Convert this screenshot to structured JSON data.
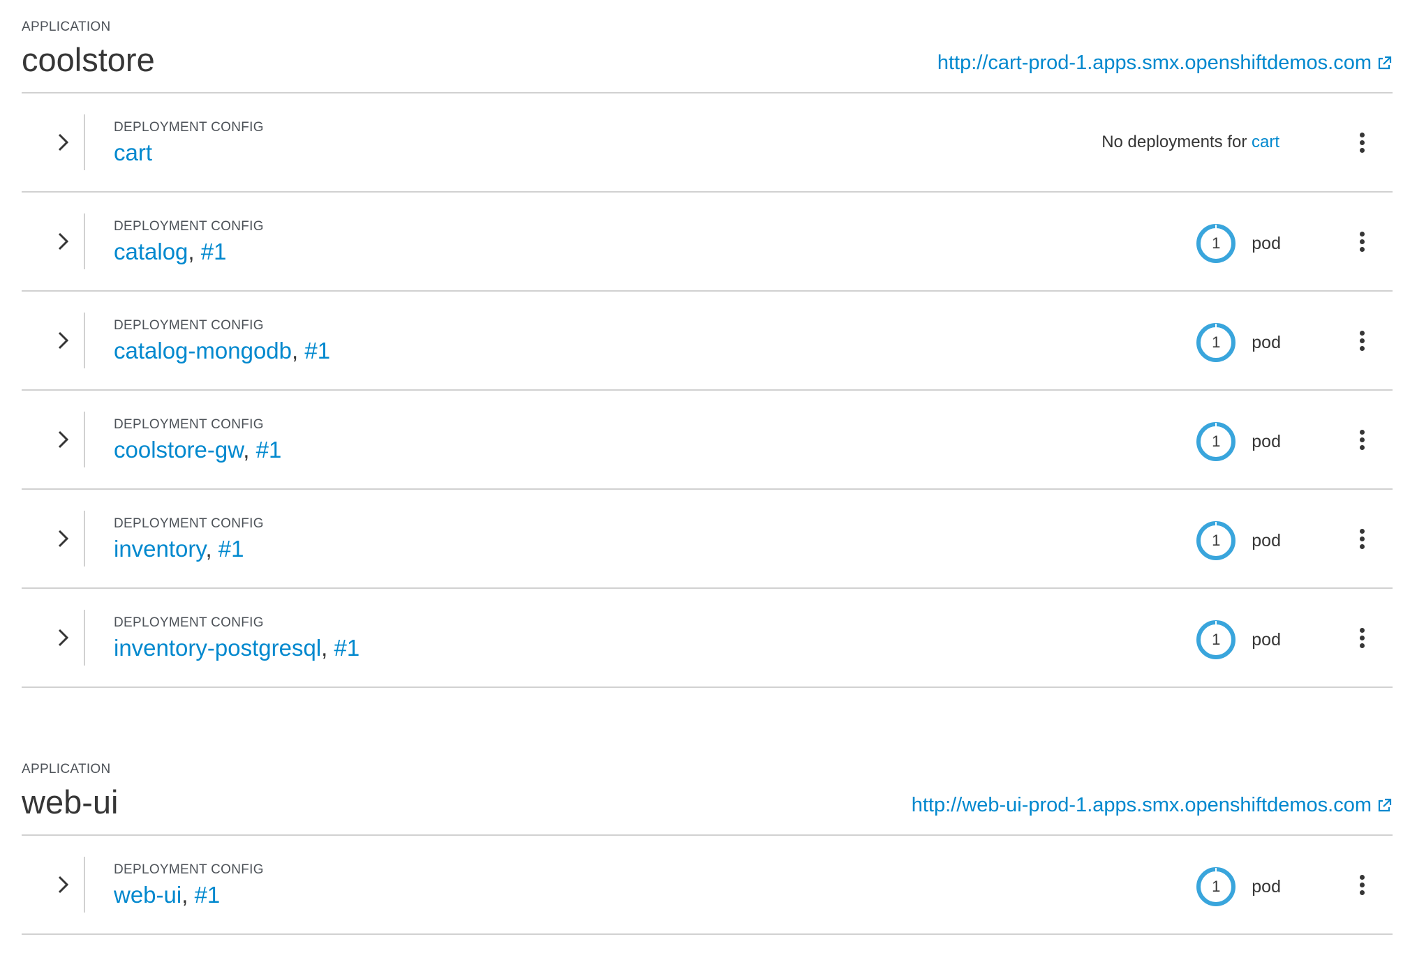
{
  "colors": {
    "link": "#0088ce",
    "donut": "#39a5dc",
    "divider": "#d1d1d1",
    "text": "#363636"
  },
  "icons": {
    "expand": "chevron-right-icon",
    "external": "external-link-icon",
    "actions": "kebab-menu-icon",
    "pods": "pod-donut"
  },
  "applications": [
    {
      "kicker": "APPLICATION",
      "name": "coolstore",
      "route": "http://cart-prod-1.apps.smx.openshiftdemos.com",
      "deployments": [
        {
          "kicker": "DEPLOYMENT CONFIG",
          "name": "cart",
          "status_prefix": "No deployments for",
          "status_link": "cart"
        },
        {
          "kicker": "DEPLOYMENT CONFIG",
          "name": "catalog",
          "sep": ", ",
          "rev": "#1",
          "pods": "1",
          "pod_label": "pod"
        },
        {
          "kicker": "DEPLOYMENT CONFIG",
          "name": "catalog-mongodb",
          "sep": ", ",
          "rev": "#1",
          "pods": "1",
          "pod_label": "pod"
        },
        {
          "kicker": "DEPLOYMENT CONFIG",
          "name": "coolstore-gw",
          "sep": ", ",
          "rev": "#1",
          "pods": "1",
          "pod_label": "pod"
        },
        {
          "kicker": "DEPLOYMENT CONFIG",
          "name": "inventory",
          "sep": ", ",
          "rev": "#1",
          "pods": "1",
          "pod_label": "pod"
        },
        {
          "kicker": "DEPLOYMENT CONFIG",
          "name": "inventory-postgresql",
          "sep": ", ",
          "rev": "#1",
          "pods": "1",
          "pod_label": "pod"
        }
      ]
    },
    {
      "kicker": "APPLICATION",
      "name": "web-ui",
      "route": "http://web-ui-prod-1.apps.smx.openshiftdemos.com",
      "deployments": [
        {
          "kicker": "DEPLOYMENT CONFIG",
          "name": "web-ui",
          "sep": ", ",
          "rev": "#1",
          "pods": "1",
          "pod_label": "pod"
        }
      ]
    }
  ]
}
